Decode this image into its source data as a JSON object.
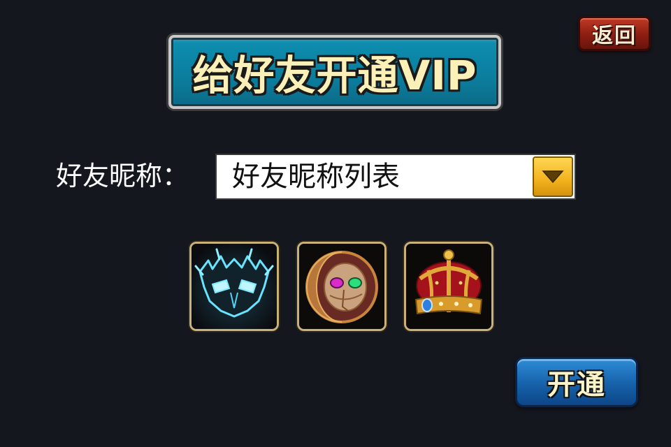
{
  "header": {
    "back_label": "返回",
    "title": "给好友开通VIP"
  },
  "form": {
    "nickname_label": "好友昵称：",
    "nickname_select_value": "好友昵称列表",
    "dropdown_icon": "triangle-down-icon"
  },
  "items": [
    {
      "name": "ice-mask-icon"
    },
    {
      "name": "crescent-mask-icon"
    },
    {
      "name": "crown-icon"
    }
  ],
  "actions": {
    "activate_label": "开通"
  },
  "colors": {
    "background": "#15171e",
    "title_banner": "#0c7d9d",
    "title_text": "#fbf0b8",
    "back_button": "#8c1d12",
    "activate_button": "#1661aa",
    "dropdown_button": "#f2b21e",
    "slot_border": "#c9b27a"
  }
}
